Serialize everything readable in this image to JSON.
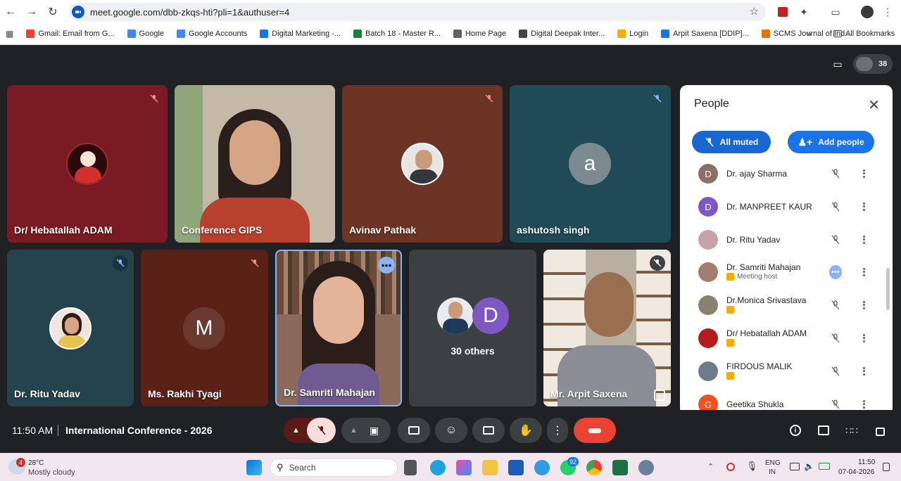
{
  "browser": {
    "url": "meet.google.com/dbb-zkqs-hti?pli=1&authuser=4",
    "bookmarks": [
      {
        "label": "Gmail: Email from G...",
        "color": "#ea4335"
      },
      {
        "label": "Google",
        "color": "#4285f4"
      },
      {
        "label": "Google Accounts",
        "color": "#4285f4"
      },
      {
        "label": "Digital Marketing -...",
        "color": "#1a73e8"
      },
      {
        "label": "Batch 18 - Master R...",
        "color": "#188038"
      },
      {
        "label": "Home Page",
        "color": "#5f6368"
      },
      {
        "label": "Digital Deepak Inter...",
        "color": "#444444"
      },
      {
        "label": "Login",
        "color": "#f9ab00"
      },
      {
        "label": "Arpit Saxena [DDIP]...",
        "color": "#1a73e8"
      },
      {
        "label": "SCMS Journal of Ind...",
        "color": "#e37400"
      }
    ],
    "more": "»",
    "all_bookmarks": "All Bookmarks"
  },
  "meeting": {
    "participant_count": "38",
    "tiles": [
      {
        "name": "Dr/ Hebatallah ADAM",
        "bg": "#7a1a22",
        "avatar": "photo"
      },
      {
        "name": "Conference GIPS",
        "bg": "#c4b9a6",
        "avatar": "video"
      },
      {
        "name": "Avinav Pathak",
        "bg": "#6b3424",
        "avatar": "photo"
      },
      {
        "name": "ashutosh singh",
        "bg": "#1f4a56",
        "avatar_letter": "a"
      },
      {
        "name": "Dr. Ritu Yadav",
        "bg": "#24434d",
        "avatar": "photo"
      },
      {
        "name": "Ms. Rakhi Tyagi",
        "bg": "#5a2216",
        "avatar_letter": "M"
      },
      {
        "name": "Dr. Samriti Mahajan",
        "bg": "#8a6b5b",
        "avatar": "video"
      },
      {
        "name": "30 others",
        "bg": "#3c4043",
        "avatar_letter": "D"
      },
      {
        "name": "Mr. Arpit Saxena",
        "bg": "#b9aea0",
        "avatar": "video"
      }
    ]
  },
  "people_panel": {
    "title": "People",
    "all_muted": "All muted",
    "add_people": "Add people",
    "people": [
      {
        "name": "Dr. ajay Sharma",
        "initial": "D",
        "color": "#8d6e63"
      },
      {
        "name": "Dr. MANPREET KAUR",
        "initial": "D",
        "color": "#7e57c2"
      },
      {
        "name": "Dr. Ritu Yadav",
        "initial": "",
        "color": "#c5a3a8"
      },
      {
        "name": "Dr. Samriti Mahajan",
        "initial": "",
        "color": "#a07d6f",
        "sub": "Meeting host"
      },
      {
        "name": "Dr.Monica Srivastava",
        "initial": "",
        "color": "#8a8070"
      },
      {
        "name": "Dr/ Hebatallah ADAM",
        "initial": "",
        "color": "#b71c1c"
      },
      {
        "name": "FIRDOUS MALIK",
        "initial": "",
        "color": "#6d7b8a"
      },
      {
        "name": "Geetika Shukla",
        "initial": "G",
        "color": "#f4511e"
      }
    ]
  },
  "bottom_bar": {
    "time": "11:50 AM",
    "meeting_name": "International Conference - 2026"
  },
  "taskbar": {
    "temperature": "28°C",
    "weather": "Mostly cloudy",
    "weather_badge": "4",
    "search_placeholder": "Search",
    "whatsapp_badge": "92",
    "lang1": "ENG",
    "lang2": "IN",
    "clock_time": "11:50",
    "clock_date": "07-04-2026"
  }
}
